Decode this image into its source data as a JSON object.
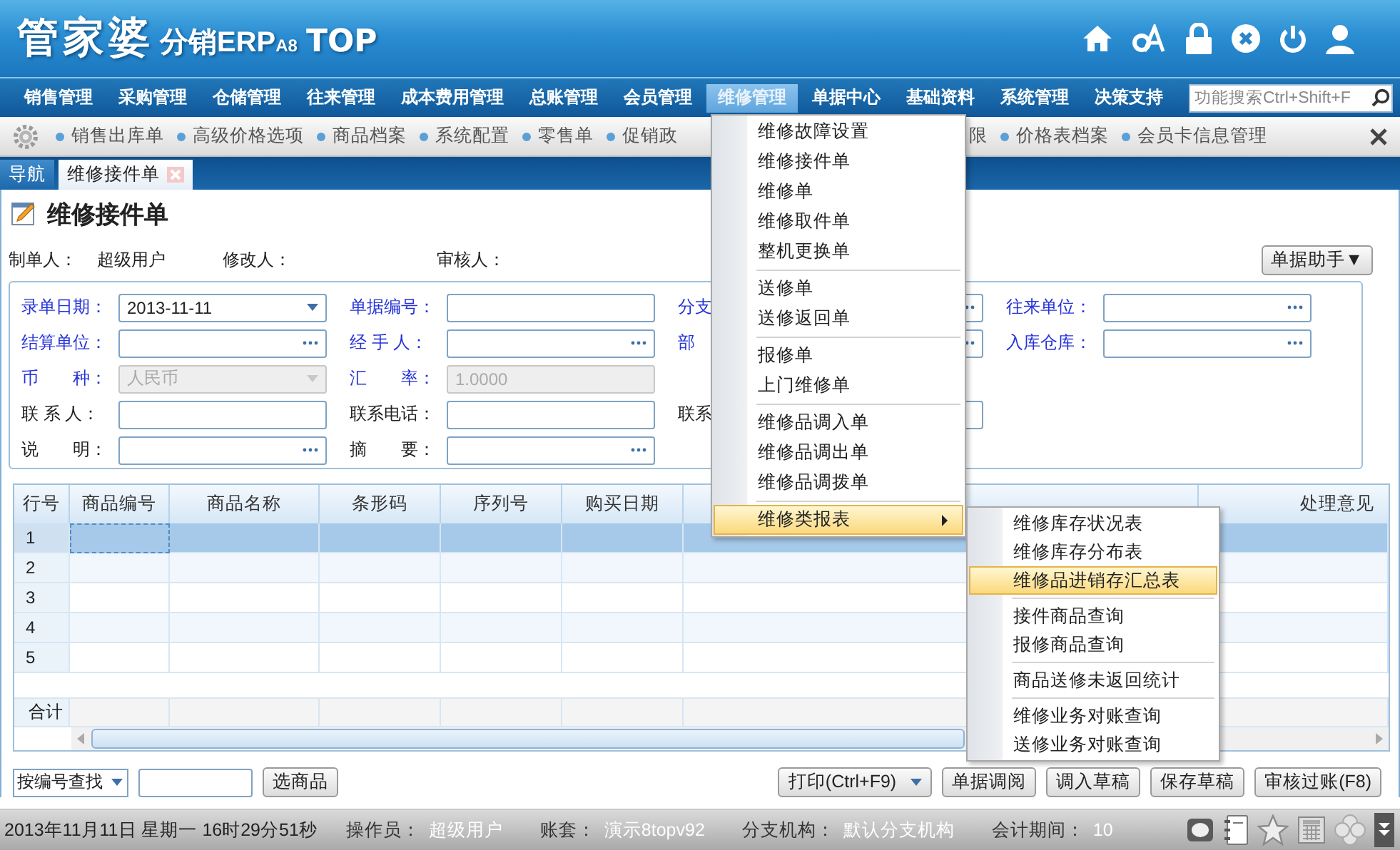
{
  "header": {
    "logo": {
      "brand": "管家婆",
      "product": "分销ERP",
      "edition": "A8",
      "suffix": "TOP"
    }
  },
  "nav": {
    "items": [
      {
        "label": "销售管理",
        "selected": false
      },
      {
        "label": "采购管理",
        "selected": false
      },
      {
        "label": "仓储管理",
        "selected": false
      },
      {
        "label": "往来管理",
        "selected": false
      },
      {
        "label": "成本费用管理",
        "selected": false
      },
      {
        "label": "总账管理",
        "selected": false
      },
      {
        "label": "会员管理",
        "selected": false
      },
      {
        "label": "维修管理",
        "selected": true
      },
      {
        "label": "单据中心",
        "selected": false
      },
      {
        "label": "基础资料",
        "selected": false
      },
      {
        "label": "系统管理",
        "selected": false
      },
      {
        "label": "决策支持",
        "selected": false
      }
    ],
    "search": {
      "placeholder": "功能搜索Ctrl+Shift+F"
    }
  },
  "quick_links": {
    "left": [
      {
        "label": "销售出库单",
        "bullet": true
      },
      {
        "label": "高级价格选项",
        "bullet": true
      },
      {
        "label": "商品档案",
        "bullet": true
      },
      {
        "label": "系统配置",
        "bullet": true
      },
      {
        "label": "零售单",
        "bullet": true
      },
      {
        "label": "促销政",
        "bullet": true
      }
    ],
    "right": [
      {
        "label": "限",
        "bullet": false
      },
      {
        "label": "价格表档案",
        "bullet": true
      },
      {
        "label": "会员卡信息管理",
        "bullet": true
      }
    ]
  },
  "tabs": [
    {
      "label": "导航",
      "selected": false,
      "closable": false
    },
    {
      "label": "维修接件单",
      "selected": true,
      "closable": true
    }
  ],
  "page": {
    "title": "维修接件单",
    "meta": [
      {
        "label": "制单人：",
        "value": "超级用户"
      },
      {
        "label": "修改人："
      },
      {
        "label": "审核人："
      }
    ],
    "helper_button": "单据助手▼"
  },
  "form": {
    "rows": [
      [
        {
          "label": "录单日期：",
          "required": true,
          "kind": "dropdown",
          "value": "2013-11-11",
          "disabled": false
        },
        {
          "label": "单据编号：",
          "required": true,
          "kind": "text",
          "disabled": false
        },
        {
          "label": "分支",
          "required": true,
          "kind": "picker",
          "disabled": false
        },
        {
          "label": "往来单位：",
          "required": true,
          "kind": "picker",
          "disabled": false
        }
      ],
      [
        {
          "label": "结算单位：",
          "required": true,
          "kind": "picker",
          "disabled": false
        },
        {
          "label": "经 手 人：",
          "required": true,
          "kind": "picker",
          "disabled": false
        },
        {
          "label": "部",
          "required": true,
          "kind": "picker",
          "disabled": false
        },
        {
          "label": "入库仓库：",
          "required": true,
          "kind": "picker",
          "disabled": false
        }
      ],
      [
        {
          "label": "币　　种：",
          "required": true,
          "kind": "dropdown",
          "value": "人民币",
          "disabled": true
        },
        {
          "label": "汇　　率：",
          "required": true,
          "kind": "text",
          "value": "1.0000",
          "disabled": true
        }
      ],
      [
        {
          "label": "联 系 人：",
          "required": false,
          "kind": "text",
          "disabled": false
        },
        {
          "label": "联系电话：",
          "required": false,
          "kind": "text",
          "disabled": false
        },
        {
          "label": "联系",
          "required": false,
          "kind": "text",
          "disabled": false
        }
      ],
      [
        {
          "label": "说　　明：",
          "required": false,
          "kind": "picker",
          "disabled": false
        },
        {
          "label": "摘　　要：",
          "required": false,
          "kind": "picker",
          "disabled": false
        }
      ]
    ]
  },
  "table": {
    "columns": [
      "行号",
      "商品编号",
      "商品名称",
      "条形码",
      "序列号",
      "购买日期",
      "处理意见"
    ],
    "rows": [
      {
        "number": "1",
        "selected": true
      },
      {
        "number": "2",
        "selected": false
      },
      {
        "number": "3",
        "selected": false
      },
      {
        "number": "4",
        "selected": false
      },
      {
        "number": "5",
        "selected": false
      }
    ],
    "total_label": "合计"
  },
  "toolbar": {
    "search_mode": "按编号查找",
    "pick_button": "选商品",
    "actions": [
      {
        "label": "打印(Ctrl+F9)",
        "kind": "dropdown"
      },
      {
        "label": "单据调阅",
        "kind": "button"
      },
      {
        "label": "调入草稿",
        "kind": "button"
      },
      {
        "label": "保存草稿",
        "kind": "button"
      },
      {
        "label": "审核过账(F8)",
        "kind": "button"
      }
    ]
  },
  "status_bar": {
    "datetime": "2013年11月11日 星期一 16时29分51秒",
    "fields": [
      {
        "label": "操作员：",
        "value": "超级用户"
      },
      {
        "label": "账套：",
        "value": "演示8topv92"
      },
      {
        "label": "分支机构：",
        "value": "默认分支机构"
      },
      {
        "label": "会计期间：",
        "value": "10"
      }
    ]
  },
  "menu": {
    "groups": [
      [
        {
          "label": "维修故障设置",
          "kind": "command",
          "selected": false
        },
        {
          "label": "维修接件单",
          "kind": "command",
          "selected": false
        },
        {
          "label": "维修单",
          "kind": "command",
          "selected": false
        },
        {
          "label": "维修取件单",
          "kind": "command",
          "selected": false
        },
        {
          "label": "整机更换单",
          "kind": "command",
          "selected": false
        }
      ],
      [
        {
          "label": "送修单",
          "kind": "command",
          "selected": false
        },
        {
          "label": "送修返回单",
          "kind": "command",
          "selected": false
        }
      ],
      [
        {
          "label": "报修单",
          "kind": "command",
          "selected": false
        },
        {
          "label": "上门维修单",
          "kind": "command",
          "selected": false
        }
      ],
      [
        {
          "label": "维修品调入单",
          "kind": "command",
          "selected": false
        },
        {
          "label": "维修品调出单",
          "kind": "command",
          "selected": false
        },
        {
          "label": "维修品调拨单",
          "kind": "command",
          "selected": false
        }
      ],
      [
        {
          "label": "维修类报表",
          "kind": "submenu",
          "selected": true
        }
      ]
    ]
  },
  "submenu": {
    "groups": [
      [
        {
          "label": "维修库存状况表",
          "selected": false
        },
        {
          "label": "维修库存分布表",
          "selected": false
        },
        {
          "label": "维修品进销存汇总表",
          "selected": true
        }
      ],
      [
        {
          "label": "接件商品查询",
          "selected": false
        },
        {
          "label": "报修商品查询",
          "selected": false
        }
      ],
      [
        {
          "label": "商品送修未返回统计",
          "selected": false
        }
      ],
      [
        {
          "label": "维修业务对账查询",
          "selected": false
        },
        {
          "label": "送修业务对账查询",
          "selected": false
        }
      ]
    ]
  }
}
